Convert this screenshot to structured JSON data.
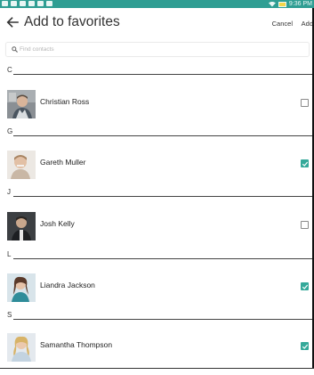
{
  "status_bar": {
    "time": "9:36 PM",
    "accent_color": "#2f9e93"
  },
  "header": {
    "title": "Add to favorites",
    "cancel_label": "Cancel",
    "add_label": "Add"
  },
  "search": {
    "placeholder": "Find contacts",
    "value": ""
  },
  "sections": [
    {
      "letter": "C",
      "contact": {
        "name": "Christian Ross",
        "selected": false
      }
    },
    {
      "letter": "G",
      "contact": {
        "name": "Gareth Muller",
        "selected": true
      }
    },
    {
      "letter": "J",
      "contact": {
        "name": "Josh Kelly",
        "selected": false
      }
    },
    {
      "letter": "L",
      "contact": {
        "name": "Liandra Jackson",
        "selected": true
      }
    },
    {
      "letter": "S",
      "contact": {
        "name": "Samantha Thompson",
        "selected": true
      }
    }
  ],
  "checkbox_checked_color": "#35a99a"
}
